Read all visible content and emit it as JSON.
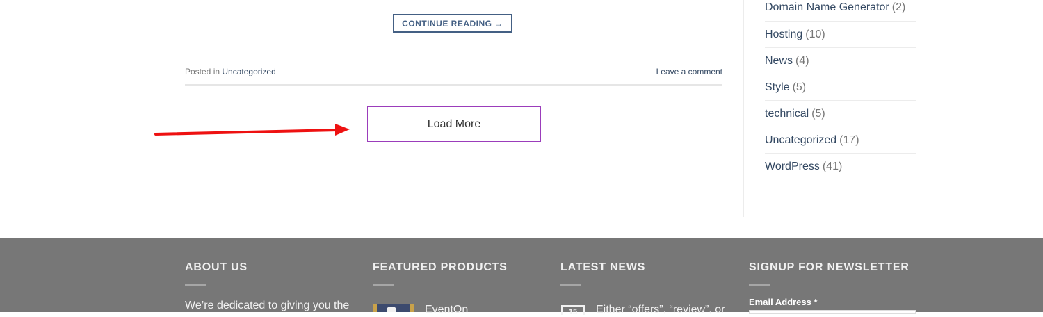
{
  "post": {
    "continue_label": "CONTINUE READING →",
    "posted_in_label": "Posted in",
    "category_link": "Uncategorized",
    "leave_comment": "Leave a comment"
  },
  "pagination": {
    "load_more_label": "Load More"
  },
  "annotation": {
    "arrow_color": "#ee1111"
  },
  "sidebar": {
    "categories": [
      {
        "name": "Domain Name Generator",
        "count": "(2)"
      },
      {
        "name": "Hosting",
        "count": "(10)"
      },
      {
        "name": "News",
        "count": "(4)"
      },
      {
        "name": "Style",
        "count": "(5)"
      },
      {
        "name": "technical",
        "count": "(5)"
      },
      {
        "name": "Uncategorized",
        "count": "(17)"
      },
      {
        "name": "WordPress",
        "count": "(41)"
      }
    ]
  },
  "footer": {
    "about": {
      "heading": "ABOUT US",
      "text": "We’re dedicated to giving you the"
    },
    "featured": {
      "heading": "FEATURED PRODUCTS",
      "product_name": "EventOn"
    },
    "news": {
      "heading": "LATEST NEWS",
      "date_day": "15",
      "item_title": "Either “offers”, “review”, or"
    },
    "newsletter": {
      "heading": "SIGNUP FOR NEWSLETTER",
      "email_label": "Email Address *"
    },
    "bg_color": "#777777"
  }
}
